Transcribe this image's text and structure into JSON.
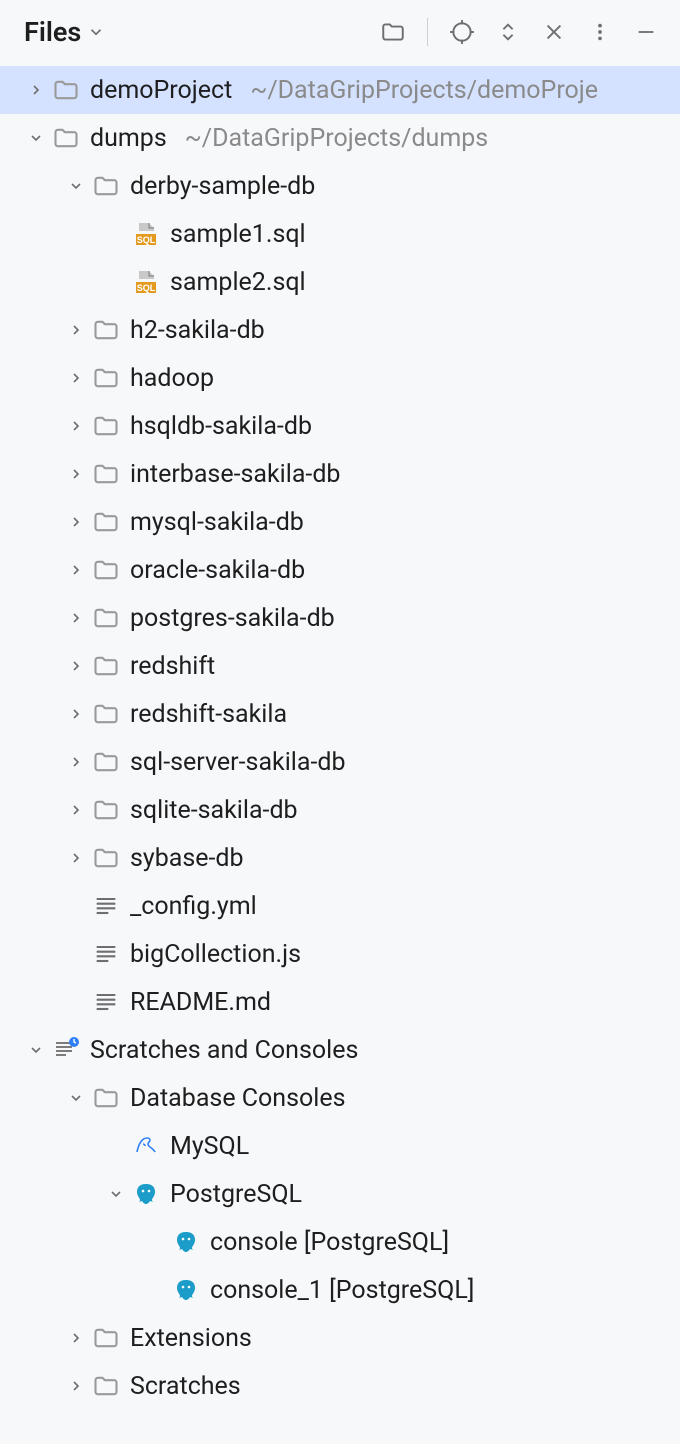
{
  "header": {
    "title": "Files"
  },
  "tree": [
    {
      "indent": 0,
      "arrow": "right",
      "icon": "folder",
      "label": "demoProject",
      "path": "~/DataGripProjects/demoProje",
      "selected": true
    },
    {
      "indent": 0,
      "arrow": "down",
      "icon": "folder",
      "label": "dumps",
      "path": "~/DataGripProjects/dumps"
    },
    {
      "indent": 1,
      "arrow": "down",
      "icon": "folder",
      "label": "derby-sample-db"
    },
    {
      "indent": 2,
      "arrow": "none",
      "icon": "sql",
      "label": "sample1.sql"
    },
    {
      "indent": 2,
      "arrow": "none",
      "icon": "sql",
      "label": "sample2.sql"
    },
    {
      "indent": 1,
      "arrow": "right",
      "icon": "folder",
      "label": "h2-sakila-db"
    },
    {
      "indent": 1,
      "arrow": "right",
      "icon": "folder",
      "label": "hadoop"
    },
    {
      "indent": 1,
      "arrow": "right",
      "icon": "folder",
      "label": "hsqldb-sakila-db"
    },
    {
      "indent": 1,
      "arrow": "right",
      "icon": "folder",
      "label": "interbase-sakila-db"
    },
    {
      "indent": 1,
      "arrow": "right",
      "icon": "folder",
      "label": "mysql-sakila-db"
    },
    {
      "indent": 1,
      "arrow": "right",
      "icon": "folder",
      "label": "oracle-sakila-db"
    },
    {
      "indent": 1,
      "arrow": "right",
      "icon": "folder",
      "label": "postgres-sakila-db"
    },
    {
      "indent": 1,
      "arrow": "right",
      "icon": "folder",
      "label": "redshift"
    },
    {
      "indent": 1,
      "arrow": "right",
      "icon": "folder",
      "label": "redshift-sakila"
    },
    {
      "indent": 1,
      "arrow": "right",
      "icon": "folder",
      "label": "sql-server-sakila-db"
    },
    {
      "indent": 1,
      "arrow": "right",
      "icon": "folder",
      "label": "sqlite-sakila-db"
    },
    {
      "indent": 1,
      "arrow": "right",
      "icon": "folder",
      "label": "sybase-db"
    },
    {
      "indent": 1,
      "arrow": "none",
      "icon": "file",
      "label": "_config.yml"
    },
    {
      "indent": 1,
      "arrow": "none",
      "icon": "file",
      "label": "bigCollection.js"
    },
    {
      "indent": 1,
      "arrow": "none",
      "icon": "file",
      "label": "README.md"
    },
    {
      "indent": 0,
      "arrow": "down",
      "icon": "scratches",
      "label": "Scratches and Consoles"
    },
    {
      "indent": 1,
      "arrow": "down",
      "icon": "folder",
      "label": "Database Consoles"
    },
    {
      "indent": 2,
      "arrow": "none",
      "icon": "mysql",
      "label": "MySQL"
    },
    {
      "indent": 2,
      "arrow": "down",
      "icon": "postgres",
      "label": "PostgreSQL"
    },
    {
      "indent": 3,
      "arrow": "none",
      "icon": "postgres",
      "label": "console [PostgreSQL]"
    },
    {
      "indent": 3,
      "arrow": "none",
      "icon": "postgres",
      "label": "console_1 [PostgreSQL]"
    },
    {
      "indent": 1,
      "arrow": "right",
      "icon": "folder",
      "label": "Extensions"
    },
    {
      "indent": 1,
      "arrow": "right",
      "icon": "folder",
      "label": "Scratches"
    }
  ]
}
